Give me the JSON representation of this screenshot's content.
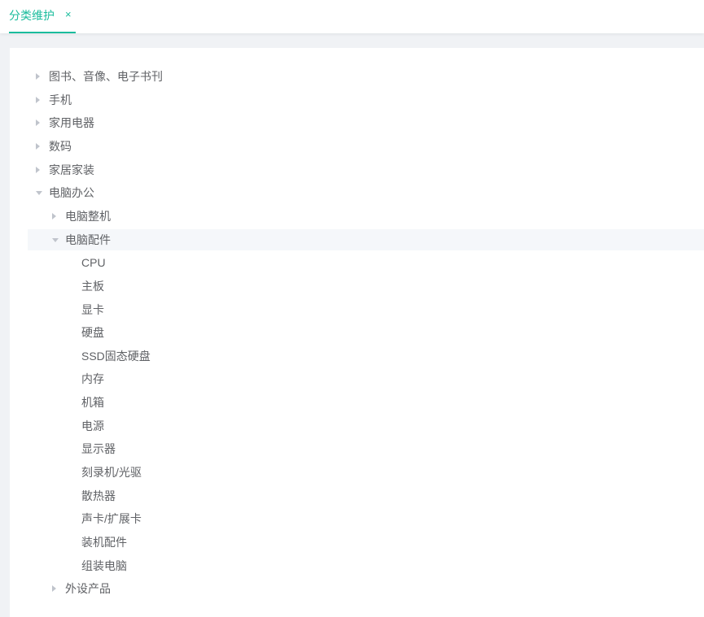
{
  "tabs": [
    {
      "label": "分类维护",
      "close_glyph": "×",
      "active": true
    }
  ],
  "colors": {
    "accent": "#1abc9c",
    "text": "#606266",
    "arrow": "#c0c4cc",
    "selected_bg": "#f5f7fa",
    "page_bg": "#f0f2f5"
  },
  "tree": [
    {
      "label": "图书、音像、电子书刊",
      "level": 0,
      "state": "collapsed"
    },
    {
      "label": "手机",
      "level": 0,
      "state": "collapsed"
    },
    {
      "label": "家用电器",
      "level": 0,
      "state": "collapsed"
    },
    {
      "label": "数码",
      "level": 0,
      "state": "collapsed"
    },
    {
      "label": "家居家装",
      "level": 0,
      "state": "collapsed"
    },
    {
      "label": "电脑办公",
      "level": 0,
      "state": "expanded"
    },
    {
      "label": "电脑整机",
      "level": 1,
      "state": "collapsed"
    },
    {
      "label": "电脑配件",
      "level": 1,
      "state": "expanded",
      "selected": true
    },
    {
      "label": "CPU",
      "level": 2,
      "state": "leaf"
    },
    {
      "label": "主板",
      "level": 2,
      "state": "leaf"
    },
    {
      "label": "显卡",
      "level": 2,
      "state": "leaf"
    },
    {
      "label": "硬盘",
      "level": 2,
      "state": "leaf"
    },
    {
      "label": "SSD固态硬盘",
      "level": 2,
      "state": "leaf"
    },
    {
      "label": "内存",
      "level": 2,
      "state": "leaf"
    },
    {
      "label": "机箱",
      "level": 2,
      "state": "leaf"
    },
    {
      "label": "电源",
      "level": 2,
      "state": "leaf"
    },
    {
      "label": "显示器",
      "level": 2,
      "state": "leaf"
    },
    {
      "label": "刻录机/光驱",
      "level": 2,
      "state": "leaf"
    },
    {
      "label": "散热器",
      "level": 2,
      "state": "leaf"
    },
    {
      "label": "声卡/扩展卡",
      "level": 2,
      "state": "leaf"
    },
    {
      "label": "装机配件",
      "level": 2,
      "state": "leaf"
    },
    {
      "label": "组装电脑",
      "level": 2,
      "state": "leaf"
    },
    {
      "label": "外设产品",
      "level": 1,
      "state": "collapsed"
    }
  ]
}
